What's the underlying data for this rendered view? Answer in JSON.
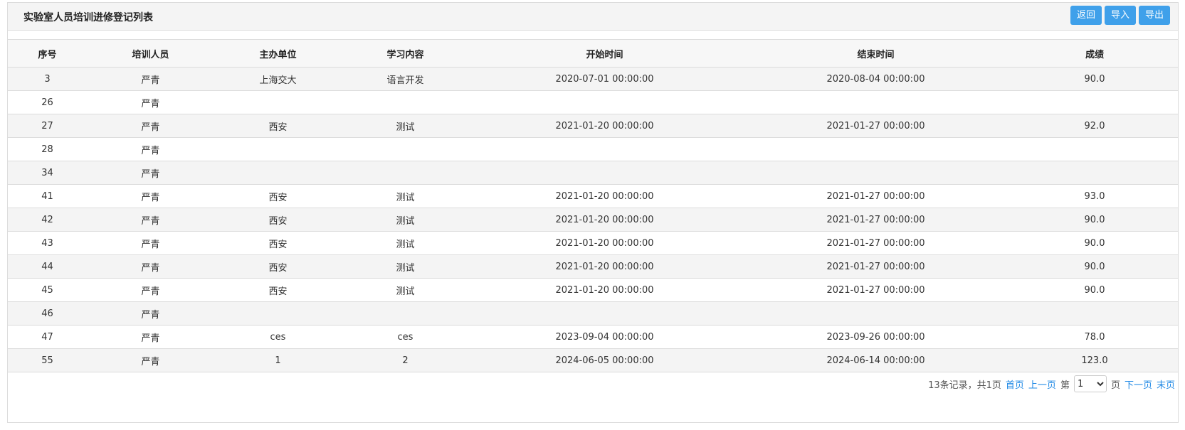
{
  "header": {
    "title": "实验室人员培训进修登记列表",
    "buttons": {
      "back": "返回",
      "import": "导入",
      "export": "导出"
    }
  },
  "table": {
    "columns": [
      "序号",
      "培训人员",
      "主办单位",
      "学习内容",
      "开始时间",
      "结束时间",
      "成绩"
    ],
    "rows": [
      [
        "3",
        "严青",
        "上海交大",
        "语言开发",
        "2020-07-01 00:00:00",
        "2020-08-04 00:00:00",
        "90.0"
      ],
      [
        "26",
        "严青",
        "",
        "",
        "",
        "",
        ""
      ],
      [
        "27",
        "严青",
        "西安",
        "测试",
        "2021-01-20 00:00:00",
        "2021-01-27 00:00:00",
        "92.0"
      ],
      [
        "28",
        "严青",
        "",
        "",
        "",
        "",
        ""
      ],
      [
        "34",
        "严青",
        "",
        "",
        "",
        "",
        ""
      ],
      [
        "41",
        "严青",
        "西安",
        "测试",
        "2021-01-20 00:00:00",
        "2021-01-27 00:00:00",
        "93.0"
      ],
      [
        "42",
        "严青",
        "西安",
        "测试",
        "2021-01-20 00:00:00",
        "2021-01-27 00:00:00",
        "90.0"
      ],
      [
        "43",
        "严青",
        "西安",
        "测试",
        "2021-01-20 00:00:00",
        "2021-01-27 00:00:00",
        "90.0"
      ],
      [
        "44",
        "严青",
        "西安",
        "测试",
        "2021-01-20 00:00:00",
        "2021-01-27 00:00:00",
        "90.0"
      ],
      [
        "45",
        "严青",
        "西安",
        "测试",
        "2021-01-20 00:00:00",
        "2021-01-27 00:00:00",
        "90.0"
      ],
      [
        "46",
        "严青",
        "",
        "",
        "",
        "",
        ""
      ],
      [
        "47",
        "严青",
        "ces",
        "ces",
        "2023-09-04 00:00:00",
        "2023-09-26 00:00:00",
        "78.0"
      ],
      [
        "55",
        "严青",
        "1",
        "2",
        "2024-06-05 00:00:00",
        "2024-06-14 00:00:00",
        "123.0"
      ]
    ]
  },
  "pagination": {
    "summary": "13条记录，共1页",
    "first": "首页",
    "prev": "上一页",
    "page_prefix": "第",
    "current_page": "1",
    "page_suffix": "页",
    "next": "下一页",
    "last": "末页"
  },
  "colors": {
    "button": "#3fa0ea",
    "link": "#1e88e5"
  }
}
